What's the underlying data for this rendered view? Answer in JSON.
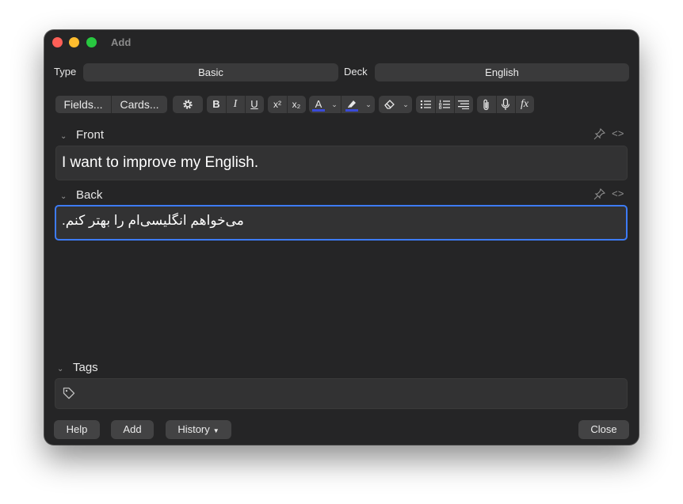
{
  "window": {
    "title": "Add"
  },
  "header": {
    "type_label": "Type",
    "type_value": "Basic",
    "deck_label": "Deck",
    "deck_value": "English"
  },
  "toolbar": {
    "fields_label": "Fields...",
    "cards_label": "Cards...",
    "bold": "B",
    "italic": "I",
    "underline": "U",
    "superscript": "x²",
    "subscript": "x₂",
    "text_color": "A",
    "formula": "fx",
    "accent_text_color": "#3a4bd8",
    "accent_highlight_color": "#3a4bd8"
  },
  "fields": [
    {
      "name": "Front",
      "value": "I want to improve my English."
    },
    {
      "name": "Back",
      "value": "می‌خواهم انگلیسی‌ام را بهتر کنم."
    }
  ],
  "tags": {
    "label": "Tags",
    "value": ""
  },
  "footer": {
    "help": "Help",
    "add": "Add",
    "history": "History",
    "close": "Close"
  },
  "colors": {
    "focus_border": "#3d7bf5",
    "window_bg": "#252526"
  }
}
